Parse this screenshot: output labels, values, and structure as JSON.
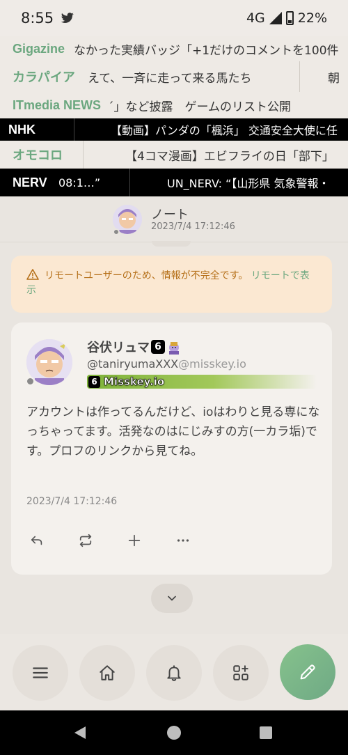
{
  "status": {
    "time": "8:55",
    "network": "4G",
    "battery": "22%"
  },
  "tickers": [
    {
      "name": "Gigazine",
      "text": "なかった実績バッジ「+1だけのコメントを100件",
      "text2": ""
    },
    {
      "name": "カラパイア",
      "text": "えて、一斉に走って来る馬たち",
      "text2": "朝"
    },
    {
      "name": "ITmedia NEWS",
      "text": "´」など披露　ゲームのリスト公開",
      "text2": ""
    },
    {
      "name": "NHK",
      "text": "【動画】パンダの「楓浜」 交通安全大使に任",
      "text2": ""
    },
    {
      "name": "オモコロ",
      "text": "【4コマ漫画】エビフライの日「部下」",
      "text2": ""
    },
    {
      "name": "NERV",
      "text": "08:1…”",
      "text2": "UN_NERV: “【山形県 気象警報・"
    }
  ],
  "header": {
    "title": "ノート",
    "date": "2023/7/4 17:12:46"
  },
  "warning": {
    "text": "リモートユーザーのため、情報が不完全です。",
    "link": "リモートで表示"
  },
  "note": {
    "display_name": "谷伏リュマ",
    "username": "@taniryumaXXX",
    "host": "@misskey.io",
    "instance_icon": "6",
    "instance": "Misskey.io",
    "text": "アカウントは作ってるんだけど、ioはわりと見る専になっちゃってます。活発なのはにじみすの方(一カラ垢)です。プロフのリンクから見てね。",
    "date": "2023/7/4 17:12:46",
    "actions": [
      "reply-icon",
      "renote-icon",
      "reaction-plus-icon",
      "more-icon"
    ]
  },
  "nav": [
    "menu-icon",
    "home-icon",
    "bell-icon",
    "widgets-icon",
    "compose-pencil-icon"
  ],
  "colors": {
    "accent": "#6ba77f",
    "warning_bg": "#fbe8d2",
    "warning_text": "#b56f18"
  }
}
